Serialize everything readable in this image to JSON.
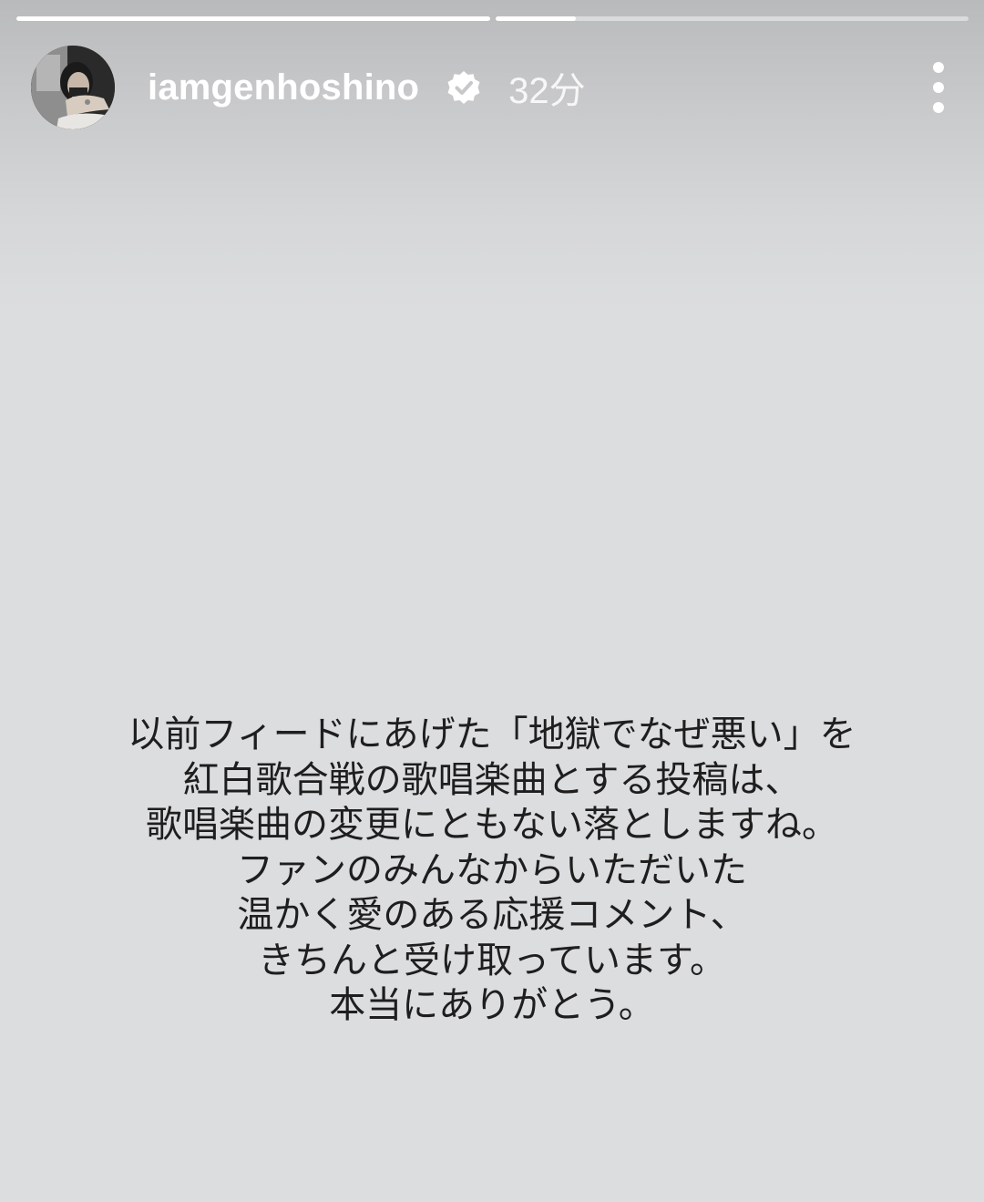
{
  "story": {
    "progress": [
      1.0,
      0.17
    ],
    "username": "iamgenhoshino",
    "time": "32分",
    "avatar_icon": "profile-photo",
    "verified_icon": "verified-badge-icon",
    "menu_icon": "more-options-icon",
    "message_lines": [
      "以前フィードにあげた「地獄でなぜ悪い」を",
      "紅白歌合戦の歌唱楽曲とする投稿は、",
      "歌唱楽曲の変更にともない落としますね。",
      "ファンのみんなからいただいた",
      "温かく愛のある応援コメント、",
      "きちんと受け取っています。",
      "本当にありがとう。"
    ]
  }
}
